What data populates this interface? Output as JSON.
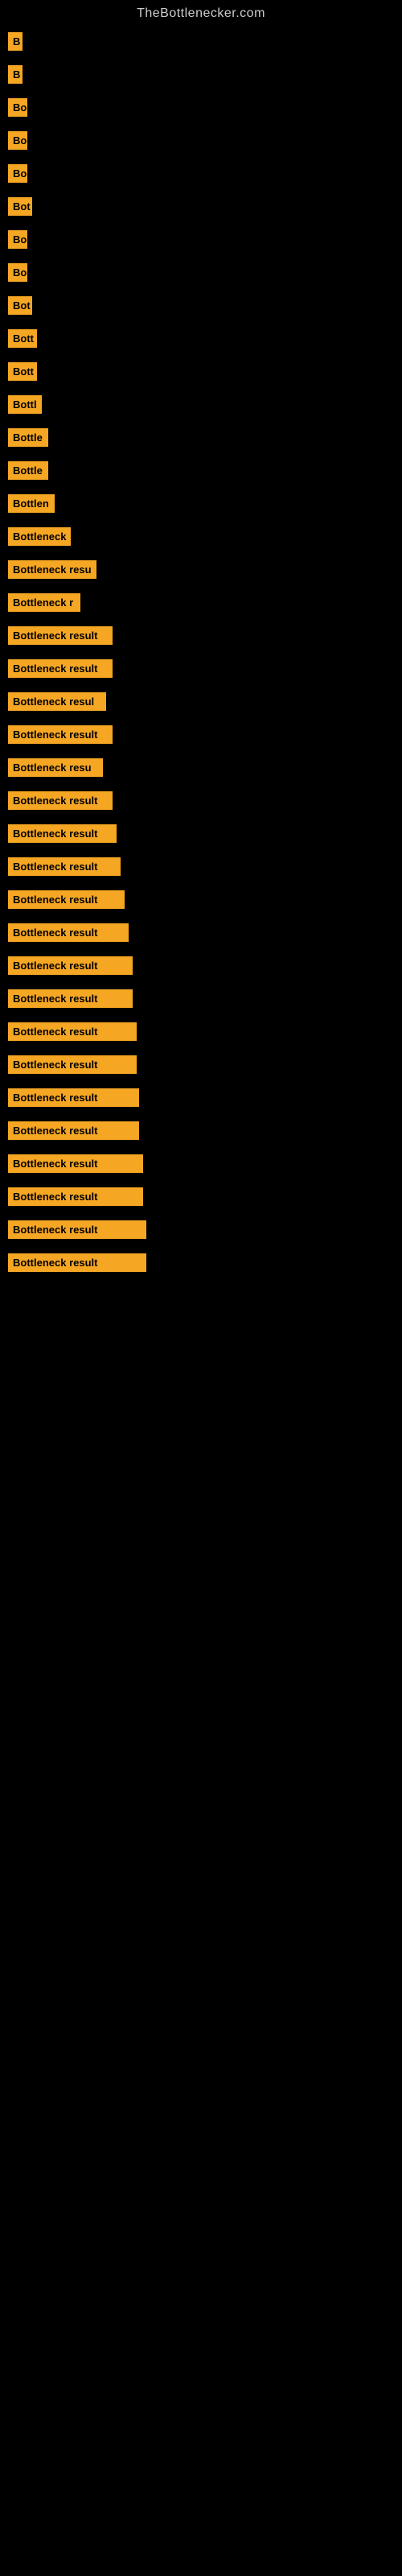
{
  "site_title": "TheBottlenecker.com",
  "items": [
    {
      "label": "B",
      "width": 18
    },
    {
      "label": "B",
      "width": 18
    },
    {
      "label": "Bo",
      "width": 24
    },
    {
      "label": "Bo",
      "width": 24
    },
    {
      "label": "Bo",
      "width": 24
    },
    {
      "label": "Bot",
      "width": 30
    },
    {
      "label": "Bo",
      "width": 24
    },
    {
      "label": "Bo",
      "width": 24
    },
    {
      "label": "Bot",
      "width": 30
    },
    {
      "label": "Bott",
      "width": 36
    },
    {
      "label": "Bott",
      "width": 36
    },
    {
      "label": "Bottl",
      "width": 42
    },
    {
      "label": "Bottle",
      "width": 50
    },
    {
      "label": "Bottle",
      "width": 50
    },
    {
      "label": "Bottlen",
      "width": 58
    },
    {
      "label": "Bottleneck",
      "width": 78
    },
    {
      "label": "Bottleneck resu",
      "width": 110
    },
    {
      "label": "Bottleneck r",
      "width": 90
    },
    {
      "label": "Bottleneck result",
      "width": 130
    },
    {
      "label": "Bottleneck result",
      "width": 130
    },
    {
      "label": "Bottleneck resul",
      "width": 122
    },
    {
      "label": "Bottleneck result",
      "width": 130
    },
    {
      "label": "Bottleneck resu",
      "width": 118
    },
    {
      "label": "Bottleneck result",
      "width": 130
    },
    {
      "label": "Bottleneck result",
      "width": 135
    },
    {
      "label": "Bottleneck result",
      "width": 140
    },
    {
      "label": "Bottleneck result",
      "width": 145
    },
    {
      "label": "Bottleneck result",
      "width": 150
    },
    {
      "label": "Bottleneck result",
      "width": 155
    },
    {
      "label": "Bottleneck result",
      "width": 155
    },
    {
      "label": "Bottleneck result",
      "width": 160
    },
    {
      "label": "Bottleneck result",
      "width": 160
    },
    {
      "label": "Bottleneck result",
      "width": 163
    },
    {
      "label": "Bottleneck result",
      "width": 163
    },
    {
      "label": "Bottleneck result",
      "width": 168
    },
    {
      "label": "Bottleneck result",
      "width": 168
    },
    {
      "label": "Bottleneck result",
      "width": 172
    },
    {
      "label": "Bottleneck result",
      "width": 172
    }
  ]
}
